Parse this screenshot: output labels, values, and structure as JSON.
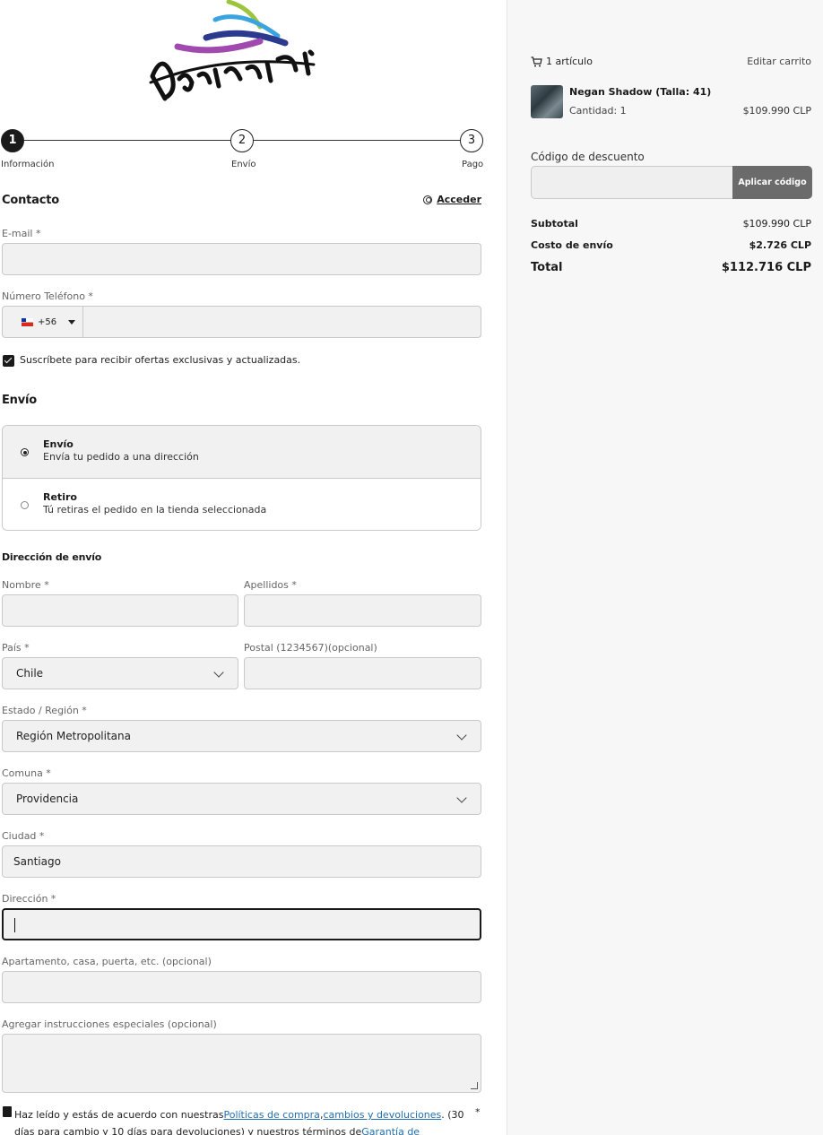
{
  "brand": {
    "name": "Bacinari"
  },
  "steps": [
    {
      "num": "1",
      "label": "Información"
    },
    {
      "num": "2",
      "label": "Envío"
    },
    {
      "num": "3",
      "label": "Pago"
    }
  ],
  "contact": {
    "title": "Contacto",
    "login_label": "Acceder",
    "email_label": "E-mail *",
    "email_value": "",
    "phone_label": "Número Teléfono *",
    "phone_prefix": "+56",
    "phone_value": "",
    "subscribe_label": "Suscríbete para recibir ofertas exclusivas y actualizadas.",
    "subscribe_checked": true
  },
  "shipping": {
    "title": "Envío",
    "options": [
      {
        "title": "Envío",
        "subtitle": "Envía tu pedido a una dirección",
        "selected": true
      },
      {
        "title": "Retiro",
        "subtitle": "Tú retiras el pedido en la tienda seleccionada",
        "selected": false
      }
    ]
  },
  "address": {
    "title": "Dirección de envío",
    "first_name_label": "Nombre *",
    "last_name_label": "Apellidos *",
    "country_label": "País *",
    "country_value": "Chile",
    "postal_label": "Postal (1234567)(opcional)",
    "region_label": "Estado / Región *",
    "region_value": "Región Metropolitana",
    "comuna_label": "Comuna *",
    "comuna_value": "Providencia",
    "city_label": "Ciudad *",
    "city_value": "Santiago",
    "address_label": "Dirección *",
    "address_value": "",
    "apartment_label": "Apartamento, casa, puerta, etc. (opcional)",
    "instructions_label": "Agregar instrucciones especiales (opcional)"
  },
  "terms": {
    "text_start": "Haz leído y estás de acuerdo con nuestras",
    "link1": "Políticas de compra",
    "comma": ",",
    "link2": "cambios y devoluciones",
    "text_mid": ". (30 días para cambio y 10 días para devoluciones) y nuestros términos de",
    "link3": "Garantía de productos",
    "required_mark": "*"
  },
  "cart": {
    "count_label": "1 artículo",
    "edit_label": "Editar carrito",
    "item": {
      "name": "Negan Shadow (Talla: 41)",
      "qty": "Cantidad: 1",
      "price": "$109.990 CLP"
    },
    "discount_label": "Código de descuento",
    "discount_button": "Aplicar código",
    "subtotal_label": "Subtotal",
    "subtotal_value": "$109.990 CLP",
    "shipping_label": "Costo de envío",
    "shipping_value": "$2.726 CLP",
    "total_label": "Total",
    "total_value": "$112.716 CLP"
  },
  "colors": {
    "accent": "#1a1a1a",
    "link": "#1f6fb2",
    "field_bg": "#f1f1f1",
    "button_bg": "#6b6b6b"
  }
}
